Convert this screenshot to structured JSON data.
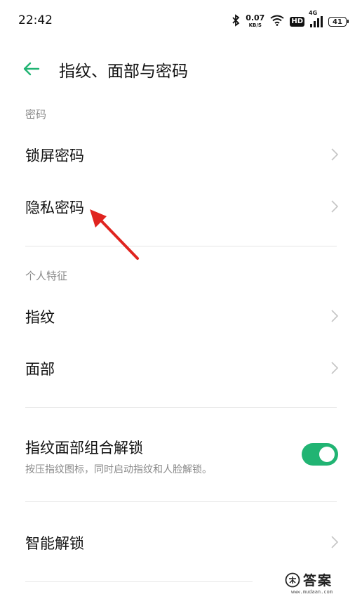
{
  "status_bar": {
    "time": "22:42",
    "net_speed_value": "0.07",
    "net_speed_unit": "KB/S",
    "hd_label": "HD",
    "network_type": "4G",
    "battery": "41"
  },
  "header": {
    "title": "指纹、面部与密码"
  },
  "sections": {
    "password": {
      "label": "密码",
      "items": [
        {
          "label": "锁屏密码"
        },
        {
          "label": "隐私密码"
        }
      ]
    },
    "personal": {
      "label": "个人特征",
      "items": [
        {
          "label": "指纹"
        },
        {
          "label": "面部"
        }
      ]
    },
    "combo": {
      "title": "指纹面部组合解锁",
      "subtitle": "按压指纹图标，同时启动指纹和人脸解锁。",
      "enabled": true
    },
    "smart": {
      "items": [
        {
          "label": "智能解锁"
        }
      ]
    }
  },
  "watermark": {
    "text": "答案",
    "url": "www.mudaan.com"
  },
  "colors": {
    "accent": "#21b473",
    "annotation": "#e0241f"
  }
}
